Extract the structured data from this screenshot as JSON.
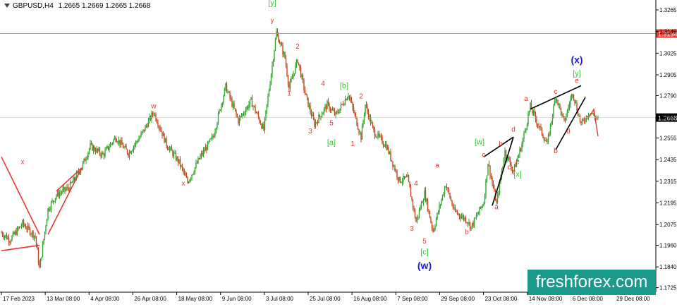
{
  "header": {
    "symbol": "GBPUSD,H4",
    "ohlc": "1.2665 1.2669 1.2665 1.2668"
  },
  "watermark": "freshforex.com",
  "colors": {
    "bull": "#2fa52f",
    "bear": "#c2491f",
    "wave_red": "#e53935",
    "wave_green": "#33cc33",
    "wave_blue": "#1a1acc",
    "trend": "#000000",
    "hline": "#f08080",
    "bg": "#ffffff"
  },
  "chart_data": {
    "type": "candlestick",
    "symbol": "GBPUSD",
    "timeframe": "H4",
    "ylim": [
      1.17,
      1.332
    ],
    "y_ticks": [
      "1.3265",
      "1.3145",
      "1.3025",
      "1.2905",
      "1.2790",
      "1.2670",
      "1.2555",
      "1.2435",
      "1.2315",
      "1.2195",
      "1.2075",
      "1.1960",
      "1.1840",
      "1.1725"
    ],
    "x_labels": [
      "17 Feb 2023",
      "13 Mar 08:00",
      "4 Apr 08:00",
      "26 Apr 08:00",
      "18 May 08:00",
      "9 Jun 08:00",
      "3 Jul 08:00",
      "25 Jul 08:00",
      "16 Aug 08:00",
      "7 Sep 08:00",
      "29 Sep 08:00",
      "23 Oct 08:00",
      "14 Nov 08:00",
      "6 Dec 08:00",
      "29 Dec 08:00"
    ],
    "price_path": [
      [
        0,
        1.203
      ],
      [
        2,
        1.199
      ],
      [
        5,
        1.208
      ],
      [
        8,
        1.201
      ],
      [
        9,
        1.183
      ],
      [
        11,
        1.216
      ],
      [
        13,
        1.224
      ],
      [
        16,
        1.228
      ],
      [
        19,
        1.2395
      ],
      [
        21,
        1.251
      ],
      [
        24,
        1.246
      ],
      [
        27,
        1.256
      ],
      [
        30,
        1.247
      ],
      [
        33,
        1.257
      ],
      [
        36,
        1.27
      ],
      [
        39,
        1.252
      ],
      [
        42,
        1.242
      ],
      [
        44,
        1.231
      ],
      [
        47,
        1.245
      ],
      [
        50,
        1.256
      ],
      [
        53,
        1.284
      ],
      [
        56,
        1.265
      ],
      [
        59,
        1.276
      ],
      [
        62,
        1.26
      ],
      [
        65,
        1.314
      ],
      [
        67,
        1.3
      ],
      [
        68,
        1.283
      ],
      [
        70,
        1.299
      ],
      [
        72,
        1.278
      ],
      [
        74,
        1.263
      ],
      [
        77,
        1.274
      ],
      [
        79,
        1.268
      ],
      [
        82,
        1.28
      ],
      [
        85,
        1.256
      ],
      [
        86,
        1.274
      ],
      [
        88,
        1.259
      ],
      [
        91,
        1.251
      ],
      [
        94,
        1.232
      ],
      [
        96,
        1.233
      ],
      [
        98,
        1.209
      ],
      [
        100,
        1.225
      ],
      [
        102,
        1.204
      ],
      [
        105,
        1.23
      ],
      [
        107,
        1.215
      ],
      [
        110,
        1.21
      ],
      [
        111,
        1.206
      ],
      [
        114,
        1.22
      ],
      [
        115,
        1.242
      ],
      [
        117,
        1.219
      ],
      [
        119,
        1.248
      ],
      [
        121,
        1.237
      ],
      [
        123,
        1.252
      ],
      [
        125,
        1.273
      ],
      [
        127,
        1.262
      ],
      [
        129,
        1.252
      ],
      [
        131,
        1.279
      ],
      [
        133,
        1.264
      ],
      [
        135,
        1.281
      ],
      [
        137,
        1.263
      ],
      [
        139,
        1.27
      ],
      [
        141,
        1.266
      ]
    ],
    "levels": [
      {
        "label": "1.3134",
        "price": 1.3134,
        "role": "horizontal line"
      }
    ],
    "current_price": {
      "label": "1.2668",
      "price": 1.2668
    },
    "wave_labels": [
      {
        "text": "x",
        "c": "red",
        "x": 5,
        "price": 1.241
      },
      {
        "text": "w",
        "c": "red",
        "x": 36,
        "price": 1.272
      },
      {
        "text": "x",
        "c": "red",
        "x": 43,
        "price": 1.229
      },
      {
        "text": "[y]",
        "c": "green",
        "x": 64,
        "price": 1.329
      },
      {
        "text": "y",
        "c": "red",
        "x": 64,
        "price": 1.3195
      },
      {
        "text": "2",
        "c": "red",
        "x": 70,
        "price": 1.305
      },
      {
        "text": "1",
        "c": "red",
        "x": 68,
        "price": 1.279
      },
      {
        "text": "4",
        "c": "red",
        "x": 76,
        "price": 1.2845
      },
      {
        "text": "3",
        "c": "red",
        "x": 73,
        "price": 1.258
      },
      {
        "text": "5",
        "c": "red",
        "x": 78,
        "price": 1.2625
      },
      {
        "text": "[a]",
        "c": "green",
        "x": 78,
        "price": 1.2515
      },
      {
        "text": "[b]",
        "c": "green",
        "x": 81,
        "price": 1.283
      },
      {
        "text": "2",
        "c": "red",
        "x": 85,
        "price": 1.2775
      },
      {
        "text": "1",
        "c": "red",
        "x": 83,
        "price": 1.251
      },
      {
        "text": "4",
        "c": "red",
        "x": 98,
        "price": 1.229
      },
      {
        "text": "3",
        "c": "red",
        "x": 97,
        "price": 1.204
      },
      {
        "text": "5",
        "c": "red",
        "x": 100,
        "price": 1.197
      },
      {
        "text": "[c]",
        "c": "green",
        "x": 100,
        "price": 1.191
      },
      {
        "text": "(w)",
        "c": "blue",
        "x": 100,
        "price": 1.183
      },
      {
        "text": "a",
        "c": "red",
        "x": 103,
        "price": 1.239
      },
      {
        "text": "b",
        "c": "red",
        "x": 110,
        "price": 1.202
      },
      {
        "text": "[w]",
        "c": "green",
        "x": 113,
        "price": 1.252
      },
      {
        "text": "c",
        "c": "red",
        "x": 114,
        "price": 1.245
      },
      {
        "text": "a",
        "c": "red",
        "x": 117,
        "price": 1.216
      },
      {
        "text": "b",
        "c": "red",
        "x": 118,
        "price": 1.251
      },
      {
        "text": "d",
        "c": "red",
        "x": 121,
        "price": 1.259
      },
      {
        "text": "c",
        "c": "red",
        "x": 120,
        "price": 1.238
      },
      {
        "text": "e",
        "c": "red",
        "x": 122,
        "price": 1.241
      },
      {
        "text": "[x]",
        "c": "green",
        "x": 122,
        "price": 1.234
      },
      {
        "text": "a",
        "c": "red",
        "x": 124,
        "price": 1.276
      },
      {
        "text": "c",
        "c": "red",
        "x": 131,
        "price": 1.28
      },
      {
        "text": "b",
        "c": "red",
        "x": 131,
        "price": 1.247
      },
      {
        "text": "d",
        "c": "red",
        "x": 134,
        "price": 1.258
      },
      {
        "text": "e",
        "c": "red",
        "x": 136,
        "price": 1.286
      },
      {
        "text": "[y]",
        "c": "green",
        "x": 136,
        "price": 1.29
      },
      {
        "text": "(x)",
        "c": "blue",
        "x": 136,
        "price": 1.297
      }
    ]
  }
}
